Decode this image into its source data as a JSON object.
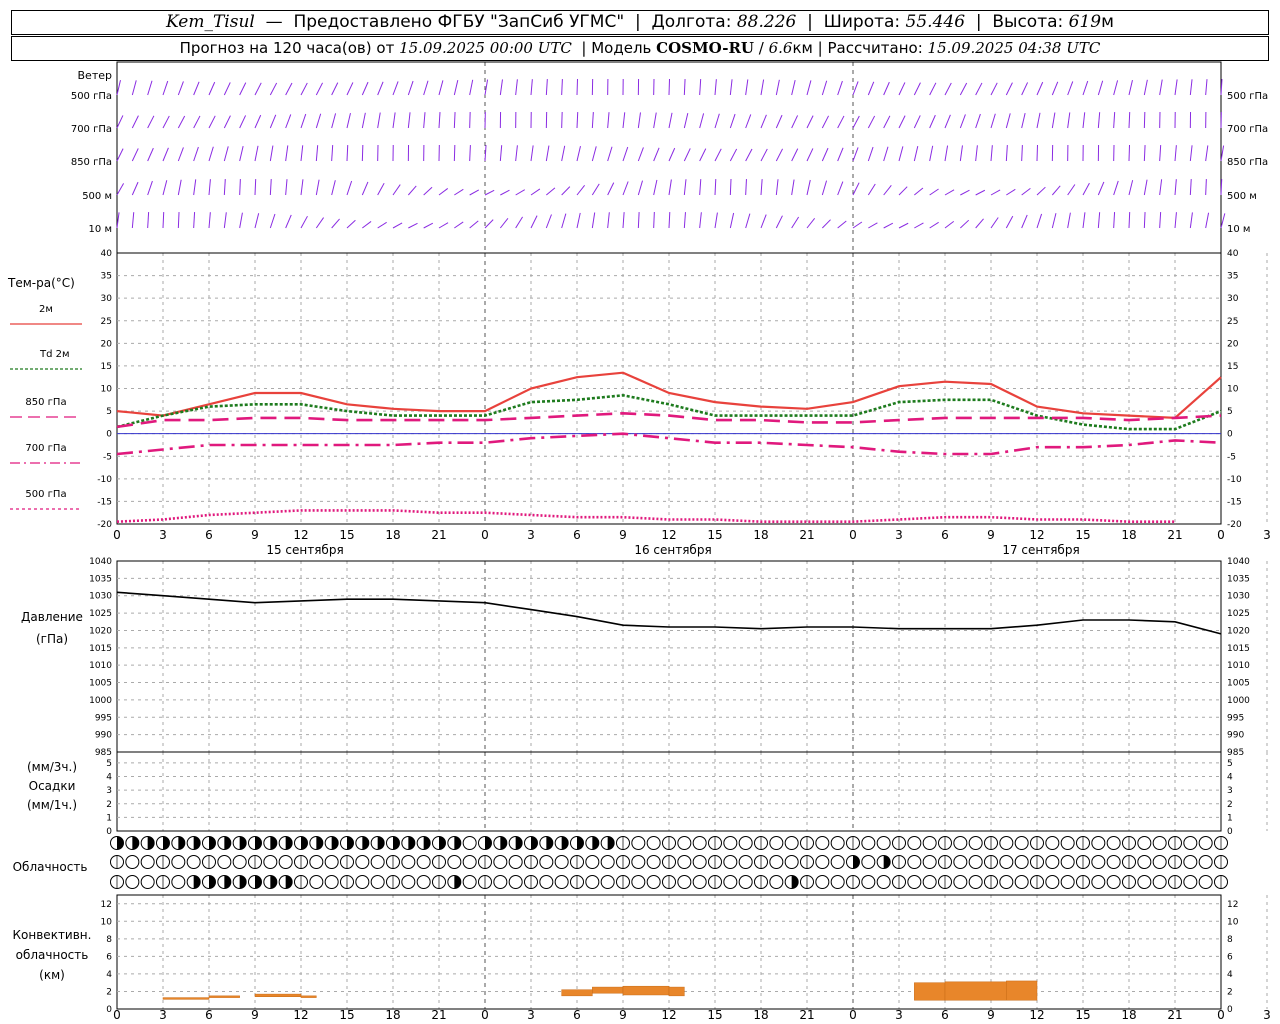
{
  "header": {
    "station": "Kem_Tisul",
    "provider": "Предоставлено ФГБУ \"ЗапСиб УГМС\"",
    "lon_label": "Долгота:",
    "lon_value": "88.226",
    "lat_label": "Широта:",
    "lat_value": "55.446",
    "alt_label": "Высота:",
    "alt_value": "619",
    "alt_unit": "м",
    "forecast_prefix": "Прогноз на 120 часа(ов) от",
    "forecast_start": "15.09.2025 00:00 UTC",
    "model_label": "Модель",
    "model_name": "COSMO-RU",
    "model_res": "6.6",
    "model_res_unit": "км",
    "calc_label": "Рассчитано:",
    "calc_time": "15.09.2025 04:38 UTC"
  },
  "wind_panel": {
    "title": "Ветер",
    "levels": [
      "500 гПа",
      "700 гПа",
      "850 гПа",
      "500 м",
      "10  м"
    ],
    "color": "#8a2be2"
  },
  "time_axis": {
    "hour_ticks": [
      "0",
      "3",
      "6",
      "9",
      "12",
      "15",
      "18",
      "21",
      "0",
      "3",
      "6",
      "9",
      "12",
      "15",
      "18",
      "21",
      "0",
      "3",
      "6",
      "9",
      "12",
      "15",
      "18",
      "21",
      "0",
      "3",
      "6"
    ],
    "day_labels": [
      "15 сентября",
      "16 сентября",
      "17 сентября"
    ]
  },
  "temperature_panel": {
    "title": "Тем-ра(°C)",
    "legend": [
      {
        "label": "2м",
        "color": "#e8423c",
        "style": "solid"
      },
      {
        "label": "Td 2м",
        "color": "#1e7b1e",
        "style": "dotted"
      },
      {
        "label": "850 гПа",
        "color": "#e0197d",
        "style": "long-dash"
      },
      {
        "label": "700 гПа",
        "color": "#e0197d",
        "style": "dash-dot"
      },
      {
        "label": "500 гПа",
        "color": "#e0197d",
        "style": "short-dot"
      }
    ],
    "y_ticks": [
      "40",
      "35",
      "30",
      "25",
      "20",
      "15",
      "10",
      "5",
      "0",
      "-5",
      "-10",
      "-15",
      "-20"
    ]
  },
  "pressure_panel": {
    "title": "Давление",
    "unit": "(гПа)",
    "y_ticks": [
      "1040",
      "1035",
      "1030",
      "1025",
      "1020",
      "1015",
      "1010",
      "1005",
      "1000",
      "995",
      "990",
      "985"
    ]
  },
  "precip_panel": {
    "unit_top": "(мм/3ч.)",
    "title": "Осадки",
    "unit_bottom": "(мм/1ч.)",
    "y_ticks": [
      "5",
      "4",
      "3",
      "2",
      "1",
      "0"
    ]
  },
  "cloud_panel": {
    "title": "Облачность"
  },
  "convective_panel": {
    "title_1": "Конвективн.",
    "title_2": "облачность",
    "unit": "(км)",
    "y_ticks": [
      "12",
      "10",
      "8",
      "6",
      "4",
      "2",
      "0"
    ],
    "color": "#e8862a"
  },
  "chart_data": [
    {
      "type": "line",
      "name": "temperature",
      "x_unit": "hours from 15.09.2025 00:00 UTC",
      "ylim": [
        -20,
        40
      ],
      "x": [
        0,
        3,
        6,
        9,
        12,
        15,
        18,
        21,
        24,
        27,
        30,
        33,
        36,
        39,
        42,
        45,
        48,
        51,
        54,
        57,
        60,
        63,
        66,
        69,
        72
      ],
      "series": [
        {
          "name": "2м",
          "values": [
            5,
            4,
            6.5,
            9,
            9,
            6.5,
            5.5,
            5,
            5,
            10,
            12.5,
            13.5,
            9,
            7,
            6,
            5.5,
            7,
            10.5,
            11.5,
            11,
            6,
            4.5,
            4,
            3.5,
            12.5
          ]
        },
        {
          "name": "Td 2м",
          "values": [
            1.5,
            4,
            6,
            6.5,
            6.5,
            5,
            4,
            4,
            4,
            7,
            7.5,
            8.5,
            6.5,
            4,
            4,
            4,
            4,
            7,
            7.5,
            7.5,
            4,
            2,
            1,
            1,
            5
          ]
        },
        {
          "name": "850 гПа",
          "values": [
            1.5,
            3,
            3,
            3.5,
            3.5,
            3,
            3,
            3,
            3,
            3.5,
            4,
            4.5,
            4,
            3,
            3,
            2.5,
            2.5,
            3,
            3.5,
            3.5,
            3.5,
            3.5,
            3,
            3.5,
            4
          ]
        },
        {
          "name": "700 гПа",
          "values": [
            -4.5,
            -3.5,
            -2.5,
            -2.5,
            -2.5,
            -2.5,
            -2.5,
            -2,
            -2,
            -1,
            -0.5,
            0,
            -1,
            -2,
            -2,
            -2.5,
            -3,
            -4,
            -4.5,
            -4.5,
            -3,
            -3,
            -2.5,
            -1.5,
            -2
          ]
        },
        {
          "name": "500 гПа",
          "values": [
            -19.5,
            -19,
            -18,
            -17.5,
            -17,
            -17,
            -17,
            -17.5,
            -17.5,
            -18,
            -18.5,
            -18.5,
            -19,
            -19,
            -19.5,
            -19.5,
            -19.5,
            -19,
            -18.5,
            -18.5,
            -19,
            -19,
            -19.5,
            -19.5,
            null
          ]
        }
      ]
    },
    {
      "type": "line",
      "name": "pressure",
      "ylim": [
        985,
        1040
      ],
      "x": [
        0,
        3,
        6,
        9,
        12,
        15,
        18,
        21,
        24,
        27,
        30,
        33,
        36,
        39,
        42,
        45,
        48,
        51,
        54,
        57,
        60,
        63,
        66,
        69,
        72
      ],
      "series": [
        {
          "name": "Давление",
          "values": [
            1031,
            1030,
            1029,
            1028,
            1028.5,
            1029,
            1029,
            1028.5,
            1028,
            1026,
            1024,
            1021.5,
            1021,
            1021,
            1020.5,
            1021,
            1021,
            1020.5,
            1020.5,
            1020.5,
            1021.5,
            1023,
            1023,
            1022.5,
            1019
          ]
        }
      ]
    },
    {
      "type": "bar",
      "name": "convective cloudiness",
      "y_unit": "km",
      "ylim": [
        0,
        13
      ],
      "segments": [
        {
          "x0": 3,
          "x1": 6,
          "bottom": 1.1,
          "top": 1.3
        },
        {
          "x0": 6,
          "x1": 8,
          "bottom": 1.3,
          "top": 1.5
        },
        {
          "x0": 9,
          "x1": 12,
          "bottom": 1.4,
          "top": 1.7
        },
        {
          "x0": 12,
          "x1": 13,
          "bottom": 1.3,
          "top": 1.5
        },
        {
          "x0": 29,
          "x1": 31,
          "bottom": 1.5,
          "top": 2.2
        },
        {
          "x0": 31,
          "x1": 33,
          "bottom": 1.8,
          "top": 2.5
        },
        {
          "x0": 33,
          "x1": 36,
          "bottom": 1.6,
          "top": 2.6
        },
        {
          "x0": 36,
          "x1": 37,
          "bottom": 1.5,
          "top": 2.5
        },
        {
          "x0": 52,
          "x1": 54,
          "bottom": 1.0,
          "top": 3.0
        },
        {
          "x0": 54,
          "x1": 58,
          "bottom": 1.0,
          "top": 3.1
        },
        {
          "x0": 58,
          "x1": 60,
          "bottom": 1.0,
          "top": 3.2
        }
      ]
    }
  ]
}
